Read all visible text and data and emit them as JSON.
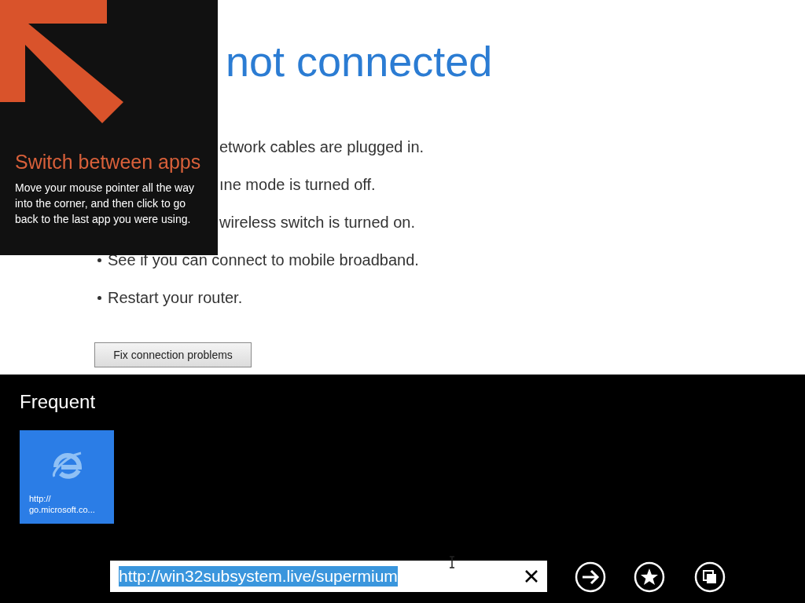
{
  "page": {
    "heading": "not connected",
    "tips": [
      {
        "kind": "partial",
        "text": "etwork cables are plugged in."
      },
      {
        "kind": "partial",
        "text": "ıne mode is turned off."
      },
      {
        "kind": "partial",
        "text": "wireless switch is turned on."
      },
      {
        "kind": "bullet",
        "text": "See if you can connect to mobile broadband."
      },
      {
        "kind": "bullet",
        "text": "Restart your router."
      }
    ],
    "button": "Fix connection problems"
  },
  "hint": {
    "title": "Switch between apps",
    "body": "Move your mouse pointer all the way into the corner, and then click to go back to the last app you were using."
  },
  "frequent": {
    "title": "Frequent",
    "tiles": [
      {
        "label": "http:// go.microsoft.co..."
      }
    ]
  },
  "address_bar": {
    "value": "http://win32subsystem.live/supermium",
    "selected": true
  }
}
